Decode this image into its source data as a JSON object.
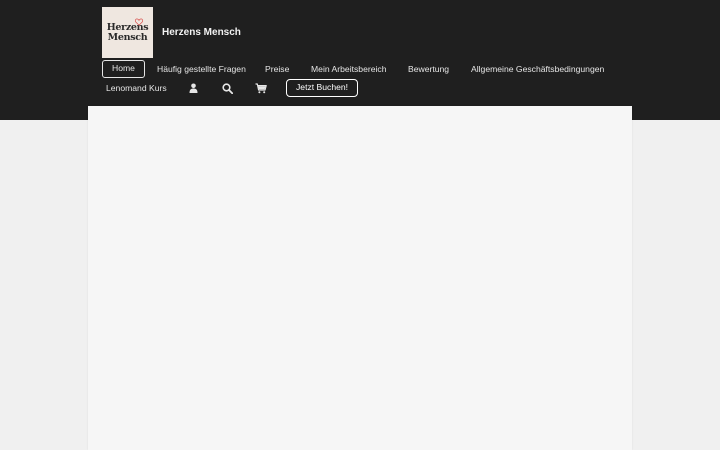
{
  "site": {
    "name": "Herzens Mensch",
    "logo_line1": "Herzens",
    "logo_line2": "Mensch"
  },
  "nav": {
    "items": [
      {
        "label": "Home",
        "active": true
      },
      {
        "label": "Häufig gestellte Fragen"
      },
      {
        "label": "Preise"
      },
      {
        "label": "Mein Arbeitsbereich"
      },
      {
        "label": "Bewertung"
      },
      {
        "label": "Allgemeine Geschäftsbedingungen"
      },
      {
        "label": "Lenomand Kurs"
      }
    ],
    "icons": [
      "user-icon",
      "search-icon",
      "cart-icon"
    ],
    "cta_label": "Jetzt Buchen!"
  },
  "colors": {
    "header_bg": "#1f1f1f",
    "page_bg": "#f0f0f0",
    "content_bg": "#f6f6f6",
    "heart": "#d9534f"
  }
}
